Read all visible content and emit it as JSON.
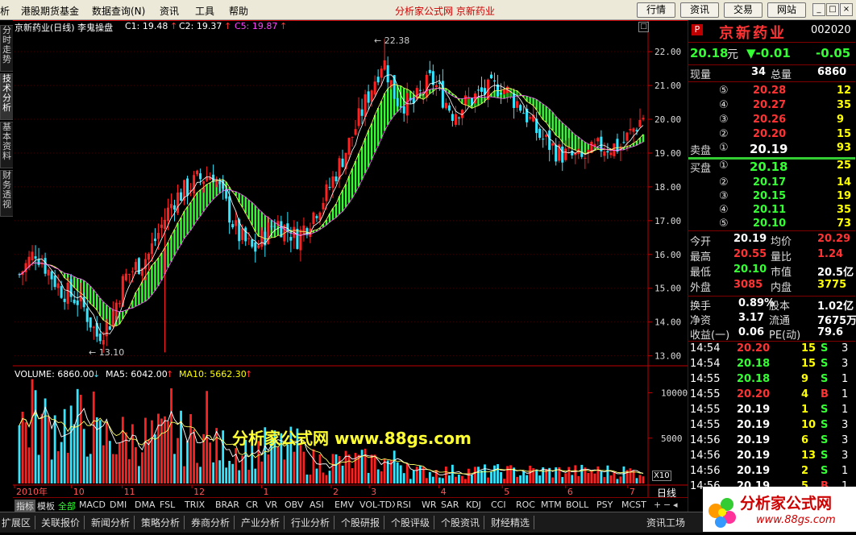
{
  "menu": {
    "left_items": [
      "析",
      "港股期货基金",
      "数据查询(N)",
      "资讯",
      "工具",
      "帮助"
    ],
    "center_title": "分析家公式网 京新药业",
    "buttons": [
      "行情",
      "资讯",
      "交易",
      "网站"
    ],
    "window_controls": [
      "_",
      "□",
      "×"
    ]
  },
  "left_tabs": [
    "分时走势",
    "技术分析",
    "基本资料",
    "财务透视"
  ],
  "price_chart": {
    "title": "京新药业(日线) 李鬼操盘",
    "indicators": [
      {
        "label": "C1: 19.48",
        "arrow": "↑",
        "color": "#ffffff"
      },
      {
        "label": "C2: 19.37",
        "arrow": "↑",
        "color": "#ffffff"
      },
      {
        "label": "C5: 19.87",
        "arrow": "↑",
        "color": "#ff44ff"
      }
    ],
    "high_label": "22.38",
    "low_label": "13.10",
    "y_ticks": [
      "22.00",
      "21.00",
      "20.00",
      "19.00",
      "18.00",
      "17.00",
      "16.00",
      "15.00",
      "14.00",
      "13.00"
    ],
    "colors": {
      "up": "#ff2020",
      "down": "#33e6ff",
      "band": "#33ff33",
      "axis": "#c00000",
      "grid": "#400000"
    }
  },
  "volume_chart": {
    "title": "VOLUME: 6860.00",
    "title_arrow": "↓",
    "ma5": "MA5: 6042.00",
    "ma5_arrow": "↑",
    "ma10": "MA10: 5662.30",
    "ma10_arrow": "↑",
    "y_ticks": [
      "10000",
      "5000"
    ],
    "multiplier": "X10",
    "watermark": "分析家公式网 www.88gs.com"
  },
  "x_axis": {
    "labels": [
      "2010年",
      "10",
      "11",
      "12",
      "1",
      "2",
      "3",
      "4",
      "5",
      "6",
      "7"
    ],
    "period": "日线"
  },
  "chart_data": {
    "type": "candlestick",
    "title": "京新药业(日线) 李鬼操盘",
    "ylim": [
      12.8,
      22.6
    ],
    "high": 22.38,
    "low": 13.1,
    "months": [
      "2010年",
      "10",
      "11",
      "12",
      "1",
      "2",
      "3",
      "4",
      "5",
      "6",
      "7"
    ],
    "volume_ma": {
      "MA5": 6042.0,
      "MA10": 5662.3
    },
    "last_volume": 6860.0
  },
  "quote": {
    "badge": "P",
    "name": "京新药业",
    "code": "002020",
    "price": "20.18",
    "unit": "元",
    "change": "▼-0.01",
    "change_pct": "-0.05",
    "xianliang_label": "现量",
    "xianliang": "34",
    "zongliang_label": "总量",
    "zongliang": "6860",
    "sell": [
      {
        "idx": "⑤",
        "price": "20.28",
        "vol": "12"
      },
      {
        "idx": "④",
        "price": "20.27",
        "vol": "35"
      },
      {
        "idx": "③",
        "price": "20.26",
        "vol": "9"
      },
      {
        "idx": "②",
        "price": "20.20",
        "vol": "15"
      }
    ],
    "sell1": {
      "label": "卖盘",
      "idx": "①",
      "price": "20.19",
      "vol": "93"
    },
    "buy1": {
      "label": "买盘",
      "idx": "①",
      "price": "20.18",
      "vol": "25"
    },
    "buy": [
      {
        "idx": "②",
        "price": "20.17",
        "vol": "14"
      },
      {
        "idx": "③",
        "price": "20.15",
        "vol": "19"
      },
      {
        "idx": "④",
        "price": "20.11",
        "vol": "35"
      },
      {
        "idx": "⑤",
        "price": "20.10",
        "vol": "73"
      }
    ],
    "stats": [
      {
        "l1": "今开",
        "v1": "20.19",
        "c1": "white",
        "l2": "均价",
        "v2": "20.29",
        "c2": "red"
      },
      {
        "l1": "最高",
        "v1": "20.55",
        "c1": "red",
        "l2": "量比",
        "v2": "1.24",
        "c2": "red"
      },
      {
        "l1": "最低",
        "v1": "20.10",
        "c1": "green",
        "l2": "市值",
        "v2": "20.5亿",
        "c2": "white"
      },
      {
        "l1": "外盘",
        "v1": "3085",
        "c1": "red",
        "l2": "内盘",
        "v2": "3775",
        "c2": "yellow"
      }
    ],
    "stats2": [
      {
        "l1": "换手",
        "v1": "0.89%",
        "l2": "股本",
        "v2": "1.02亿"
      },
      {
        "l1": "净资",
        "v1": "3.17",
        "l2": "流通",
        "v2": "7675万"
      },
      {
        "l1": "收益(一)",
        "v1": "0.06",
        "l2": "PE(动)",
        "v2": "79.6"
      }
    ],
    "ticks": [
      {
        "time": "14:54",
        "price": "20.20",
        "pc": "red",
        "vol": "15",
        "flag": "S",
        "fc": "green",
        "n": "3"
      },
      {
        "time": "14:54",
        "price": "20.18",
        "pc": "green",
        "vol": "15",
        "flag": "S",
        "fc": "green",
        "n": "3"
      },
      {
        "time": "14:55",
        "price": "20.18",
        "pc": "green",
        "vol": "9",
        "flag": "S",
        "fc": "green",
        "n": "1"
      },
      {
        "time": "14:55",
        "price": "20.20",
        "pc": "red",
        "vol": "4",
        "flag": "B",
        "fc": "red",
        "n": "1"
      },
      {
        "time": "14:55",
        "price": "20.19",
        "pc": "white",
        "vol": "1",
        "flag": "S",
        "fc": "green",
        "n": "1"
      },
      {
        "time": "14:55",
        "price": "20.19",
        "pc": "white",
        "vol": "10",
        "flag": "S",
        "fc": "green",
        "n": "3"
      },
      {
        "time": "14:56",
        "price": "20.19",
        "pc": "white",
        "vol": "6",
        "flag": "S",
        "fc": "green",
        "n": "3"
      },
      {
        "time": "14:56",
        "price": "20.19",
        "pc": "white",
        "vol": "13",
        "flag": "S",
        "fc": "green",
        "n": "3"
      },
      {
        "time": "14:56",
        "price": "20.19",
        "pc": "white",
        "vol": "2",
        "flag": "S",
        "fc": "green",
        "n": "1"
      },
      {
        "time": "14:56",
        "price": "20.19",
        "pc": "white",
        "vol": "5",
        "flag": "B",
        "fc": "red",
        "n": "1"
      }
    ]
  },
  "indicator_tabs": [
    "指标",
    "模板",
    "全部",
    "MACD",
    "DMI",
    "DMA",
    "FSL",
    "TRIX",
    "BRAR",
    "CR",
    "VR",
    "OBV",
    "ASI",
    "EMV",
    "VOL-TDX",
    "RSI",
    "WR",
    "SAR",
    "KDJ",
    "CCI",
    "ROC",
    "MTM",
    "BOLL",
    "PSY",
    "MCST"
  ],
  "bottom_tabs": [
    "扩展区",
    "关联报价",
    "新闻分析",
    "策略分析",
    "券商分析",
    "产业分析",
    "行业分析",
    "个股研报",
    "个股评级",
    "个股资讯",
    "财经精选"
  ],
  "bottom_right": "资讯工场",
  "logo": {
    "text": "分析家公式网",
    "url": "www.88gs.com"
  }
}
